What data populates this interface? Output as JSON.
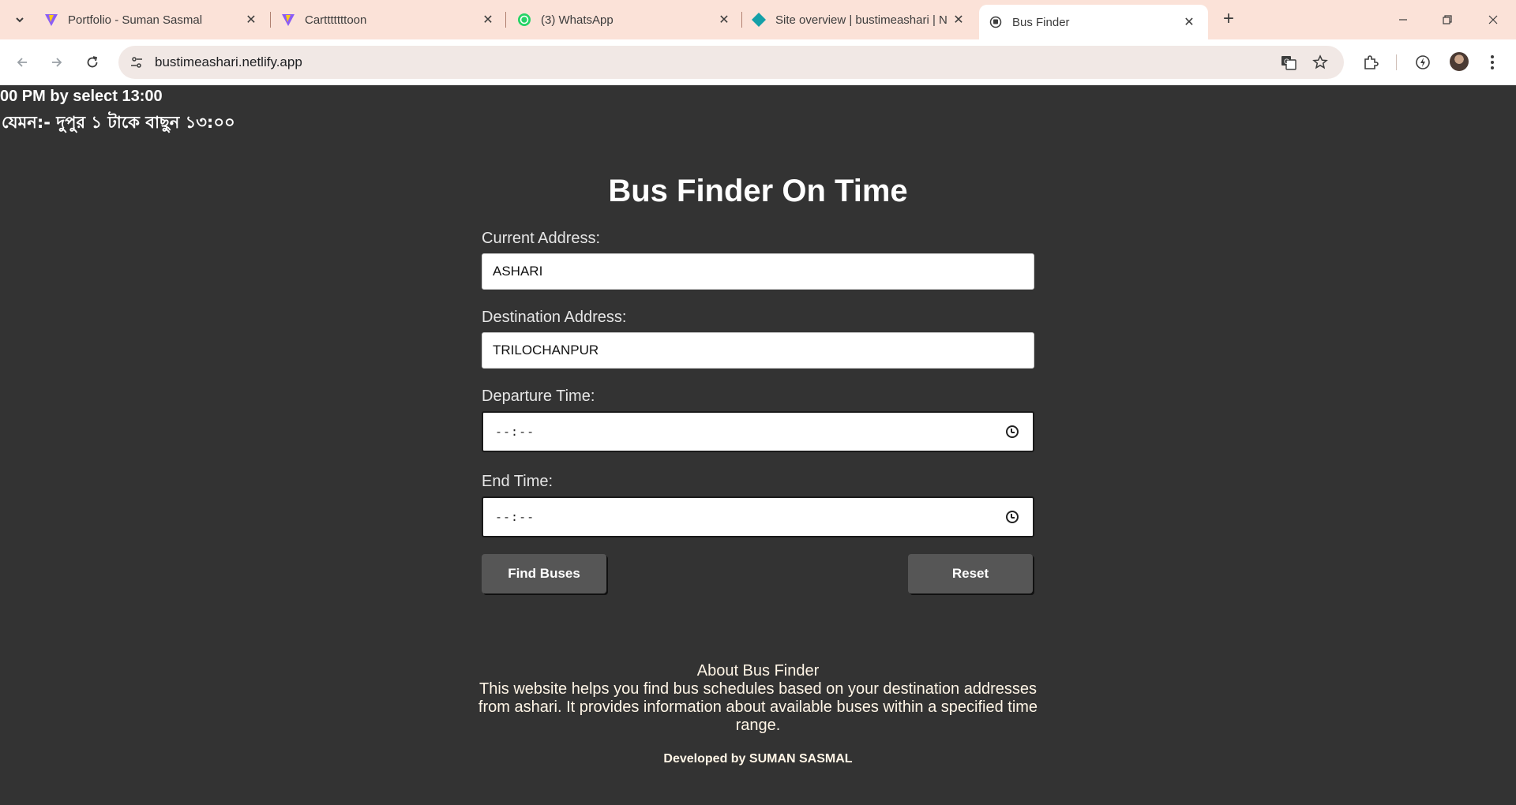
{
  "browser": {
    "tabs": [
      {
        "title": "Portfolio - Suman Sasmal",
        "icon": "vite-icon",
        "active": false
      },
      {
        "title": "Cartttttttoon",
        "icon": "vite-icon",
        "active": false
      },
      {
        "title": "(3) WhatsApp",
        "icon": "whatsapp-icon",
        "active": false
      },
      {
        "title": "Site overview | bustimeashari | N",
        "icon": "netlify-icon",
        "active": false
      },
      {
        "title": "Bus Finder",
        "icon": "site-icon",
        "active": true
      }
    ],
    "url": "bustimeashari.netlify.app"
  },
  "page": {
    "marquee_line_1": "00 PM by select 13:00",
    "marquee_line_2": "যেমন:- দুপুর ১ টাকে বাছুন ১৩:০০",
    "heading": "Bus Finder On Time",
    "form": {
      "current_label": "Current Address:",
      "current_value": "ASHARI",
      "destination_label": "Destination Address:",
      "destination_value": "TRILOCHANPUR",
      "departure_label": "Departure Time:",
      "departure_placeholder": "--:--",
      "end_label": "End Time:",
      "end_placeholder": "--:--",
      "find_label": "Find Buses",
      "reset_label": "Reset"
    },
    "about": {
      "title": "About Bus Finder",
      "text": "This website helps you find bus schedules based on your destination addresses from ashari. It provides information about available buses within a specified time range."
    },
    "developer": "Developed by SUMAN SASMAL"
  }
}
